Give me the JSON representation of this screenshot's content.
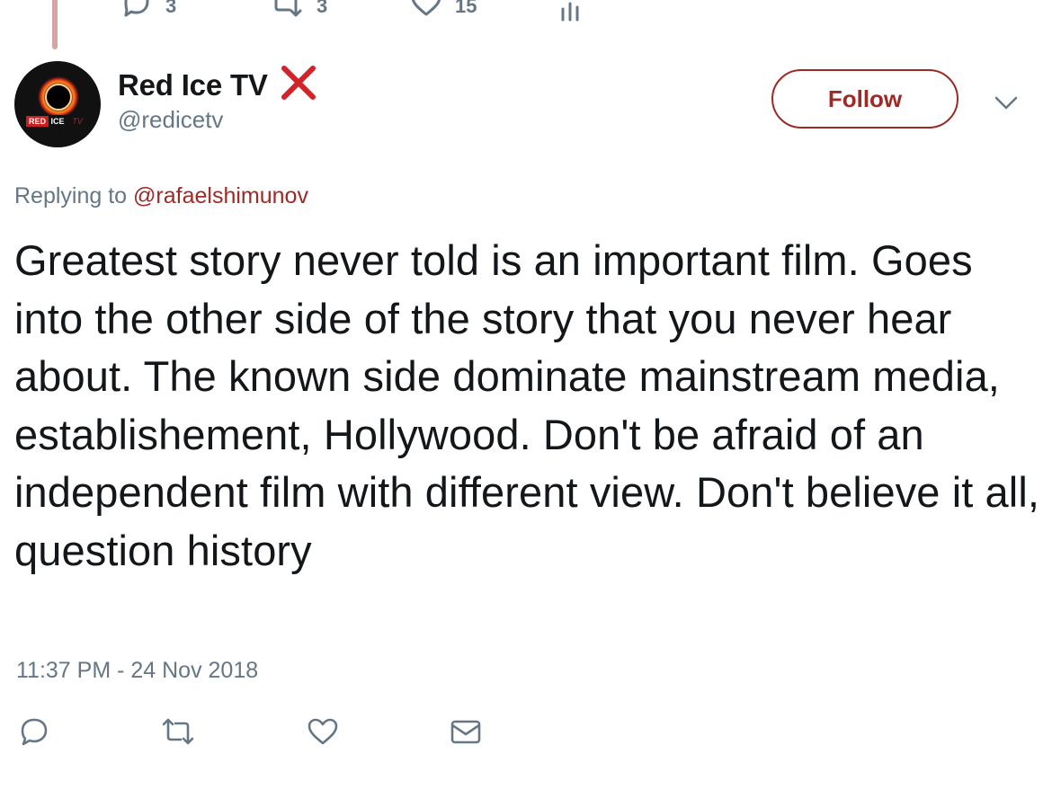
{
  "previous_tweet": {
    "reply_count": "3",
    "retweet_count": "3",
    "like_count": "15"
  },
  "tweet": {
    "author": {
      "display_name": "Red Ice TV",
      "handle": "@redicetv",
      "avatar_text": "RED ICE TV"
    },
    "follow_label": "Follow",
    "replying_prefix": "Replying to ",
    "replying_to": "@rafaelshimunov",
    "text": "Greatest story never told is an important film. Goes into the other side of the story that you never hear about. The known side dominate mainstream media, establishement, Hollywood. Don't be afraid of an independent film with different view. Don't believe it all, question history",
    "timestamp": "11:37 PM - 24 Nov 2018"
  },
  "icons": {
    "reply": "reply-icon",
    "retweet": "retweet-icon",
    "like": "heart-icon",
    "message": "envelope-icon",
    "analytics": "analytics-icon",
    "more": "chevron-down-icon",
    "badge": "red-x-icon"
  },
  "colors": {
    "accent": "#9e2a26",
    "secondary_text": "#657786",
    "primary_text": "#14171a",
    "thread_line": "#d4a7a5",
    "badge": "#d2232a"
  }
}
